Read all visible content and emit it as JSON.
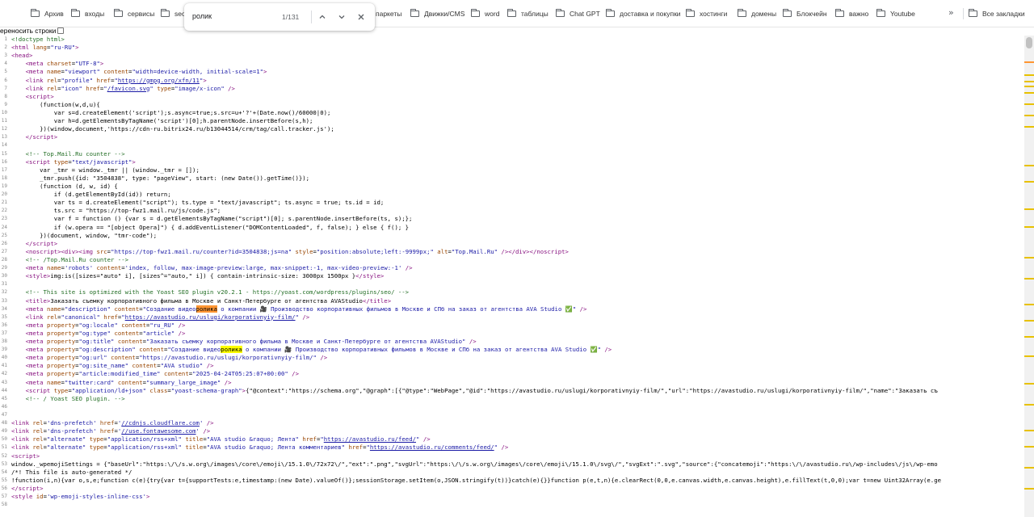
{
  "bookmarks": {
    "items": [
      {
        "label": "Архив"
      },
      {
        "label": "входы"
      },
      {
        "label": "сервисы"
      },
      {
        "label": "seo"
      },
      {
        "label": "паркеты"
      },
      {
        "label": "Движки/CMS"
      },
      {
        "label": "word"
      },
      {
        "label": "таблицы"
      },
      {
        "label": "Chat GPT"
      },
      {
        "label": "доставка и покупки"
      },
      {
        "label": "хостинги"
      },
      {
        "label": "домены"
      },
      {
        "label": "Блокчейн"
      },
      {
        "label": "важно"
      },
      {
        "label": "Youtube"
      }
    ],
    "more": "»",
    "all_label": "Все закладки"
  },
  "wrap": {
    "label": "ереносить строки"
  },
  "find": {
    "query": "ролик",
    "count": "1/131",
    "prev": "⌃",
    "next": "⌄",
    "close": "✕"
  },
  "code": {
    "lines": [
      {
        "n": "1",
        "html": "<span class=\"c\">&lt;!doctype html&gt;</span>"
      },
      {
        "n": "2",
        "html": "<span class=\"t\">&lt;html</span> <span class=\"a\">lang</span>=<span class=\"v\">\"ru-RU\"</span><span class=\"t\">&gt;</span>"
      },
      {
        "n": "3",
        "html": "<span class=\"t\">&lt;head&gt;</span>"
      },
      {
        "n": "4",
        "html": "    <span class=\"t\">&lt;meta</span> <span class=\"a\">charset</span>=<span class=\"v\">\"UTF-8\"</span><span class=\"t\">&gt;</span>"
      },
      {
        "n": "5",
        "html": "    <span class=\"t\">&lt;meta</span> <span class=\"a\">name</span>=<span class=\"v\">\"viewport\"</span> <span class=\"a\">content</span>=<span class=\"v\">\"width=device-width, initial-scale=1\"</span><span class=\"t\">&gt;</span>"
      },
      {
        "n": "6",
        "html": "    <span class=\"t\">&lt;link</span> <span class=\"a\">rel</span>=<span class=\"v\">\"profile\"</span> <span class=\"a\">href</span>=<span class=\"v\">\"</span><span class=\"u\">https://gmpg.org/xfn/11</span><span class=\"v\">\"</span><span class=\"t\">&gt;</span>"
      },
      {
        "n": "7",
        "html": "    <span class=\"t\">&lt;link</span> <span class=\"a\">rel</span>=<span class=\"v\">\"icon\"</span> <span class=\"a\">href</span>=<span class=\"v\">\"</span><span class=\"u\">/favicon.svg</span><span class=\"v\">\"</span> <span class=\"a\">type</span>=<span class=\"v\">\"image/x-icon\"</span> <span class=\"t\">/&gt;</span>"
      },
      {
        "n": "8",
        "html": "    <span class=\"t\">&lt;script&gt;</span>"
      },
      {
        "n": "9",
        "html": "        (function(w,d,u){"
      },
      {
        "n": "10",
        "html": "            var s=d.createElement('script');s.async=true;s.src=u+'?'+(Date.now()/60000|0);"
      },
      {
        "n": "11",
        "html": "            var h=d.getElementsByTagName('script')[0];h.parentNode.insertBefore(s,h);"
      },
      {
        "n": "12",
        "html": "        })(window,document,'https://cdn-ru.bitrix24.ru/b13044514/crm/tag/call.tracker.js');"
      },
      {
        "n": "13",
        "html": "    <span class=\"t\">&lt;/script&gt;</span>"
      },
      {
        "n": "14",
        "html": ""
      },
      {
        "n": "15",
        "html": "    <span class=\"c\">&lt;!-- Top.Mail.Ru counter --&gt;</span>"
      },
      {
        "n": "16",
        "html": "    <span class=\"t\">&lt;script</span> <span class=\"a\">type</span>=<span class=\"v\">\"text/javascript\"</span><span class=\"t\">&gt;</span>"
      },
      {
        "n": "17",
        "html": "        var _tmr = window._tmr || (window._tmr = []);"
      },
      {
        "n": "18",
        "html": "        _tmr.push({id: \"3504838\", type: \"pageView\", start: (new Date()).getTime()});"
      },
      {
        "n": "19",
        "html": "        (function (d, w, id) {"
      },
      {
        "n": "20",
        "html": "            if (d.getElementById(id)) return;"
      },
      {
        "n": "21",
        "html": "            var ts = d.createElement(\"script\"); ts.type = \"text/javascript\"; ts.async = true; ts.id = id;"
      },
      {
        "n": "22",
        "html": "            ts.src = \"https://top-fwz1.mail.ru/js/code.js\";"
      },
      {
        "n": "23",
        "html": "            var f = function () {var s = d.getElementsByTagName(\"script\")[0]; s.parentNode.insertBefore(ts, s);};"
      },
      {
        "n": "24",
        "html": "            if (w.opera == \"[object Opera]\") { d.addEventListener(\"DOMContentLoaded\", f, false); } else { f(); }"
      },
      {
        "n": "25",
        "html": "        })(document, window, \"tmr-code\");"
      },
      {
        "n": "26",
        "html": "    <span class=\"t\">&lt;/script&gt;</span>"
      },
      {
        "n": "27",
        "html": "    <span class=\"t\">&lt;noscript&gt;&lt;div&gt;&lt;img</span> <span class=\"a\">src</span>=<span class=\"v\">\"https://top-fwz1.mail.ru/counter?id=3504838;js=na\"</span> <span class=\"a\">style</span>=<span class=\"v\">\"position:absolute;left:-9999px;\"</span> <span class=\"a\">alt</span>=<span class=\"v\">\"Top.Mail.Ru\"</span> <span class=\"t\">/&gt;&lt;/div&gt;&lt;/noscript&gt;</span>"
      },
      {
        "n": "28",
        "html": "    <span class=\"c\">&lt;!-- /Top.Mail.Ru counter --&gt;</span>"
      },
      {
        "n": "29",
        "html": "    <span class=\"t\">&lt;meta</span> <span class=\"a\">name</span>=<span class=\"v\">'robots'</span> <span class=\"a\">content</span>=<span class=\"v\">'index, follow, max-image-preview:large, max-snippet:-1, max-video-preview:-1'</span> <span class=\"t\">/&gt;</span>"
      },
      {
        "n": "30",
        "html": "    <span class=\"t\">&lt;style&gt;</span>img:is([sizes=\"auto\" i], [sizes^=\"auto,\" i]) { contain-intrinsic-size: 3000px 1500px }<span class=\"t\">&lt;/style&gt;</span>"
      },
      {
        "n": "31",
        "html": ""
      },
      {
        "n": "32",
        "html": "    <span class=\"c\">&lt;!-- This site is optimized with the Yoast SEO plugin v20.2.1 - https://yoast.com/wordpress/plugins/seo/ --&gt;</span>"
      },
      {
        "n": "33",
        "html": "    <span class=\"t\">&lt;title&gt;</span>Заказать съемку корпоративного фильма в Москве и Санкт-Петербурге от агентства AVAStudio<span class=\"t\">&lt;/title&gt;</span>"
      },
      {
        "n": "34",
        "html": "    <span class=\"t\">&lt;meta</span> <span class=\"a\">name</span>=<span class=\"v\">\"description\"</span> <span class=\"a\">content</span>=<span class=\"v\">\"Создание видео<mark class=\"cur\">ролика</mark> о компании 🎥 Производство корпоративных фильмов в Москве и СПб на заказ от агентства AVA Studio ✅\"</span> <span class=\"t\">/&gt;</span>"
      },
      {
        "n": "35",
        "html": "    <span class=\"t\">&lt;link</span> <span class=\"a\">rel</span>=<span class=\"v\">\"canonical\"</span> <span class=\"a\">href</span>=<span class=\"v\">\"</span><span class=\"u\">https://avastudio.ru/uslugi/korporativnyiy-film/</span><span class=\"v\">\"</span> <span class=\"t\">/&gt;</span>"
      },
      {
        "n": "36",
        "html": "    <span class=\"t\">&lt;meta</span> <span class=\"a\">property</span>=<span class=\"v\">\"og:locale\"</span> <span class=\"a\">content</span>=<span class=\"v\">\"ru_RU\"</span> <span class=\"t\">/&gt;</span>"
      },
      {
        "n": "37",
        "html": "    <span class=\"t\">&lt;meta</span> <span class=\"a\">property</span>=<span class=\"v\">\"og:type\"</span> <span class=\"a\">content</span>=<span class=\"v\">\"article\"</span> <span class=\"t\">/&gt;</span>"
      },
      {
        "n": "38",
        "html": "    <span class=\"t\">&lt;meta</span> <span class=\"a\">property</span>=<span class=\"v\">\"og:title\"</span> <span class=\"a\">content</span>=<span class=\"v\">\"Заказать съемку корпоративного фильма в Москве и Санкт-Петербурге от агентства AVAStudio\"</span> <span class=\"t\">/&gt;</span>"
      },
      {
        "n": "39",
        "html": "    <span class=\"t\">&lt;meta</span> <span class=\"a\">property</span>=<span class=\"v\">\"og:description\"</span> <span class=\"a\">content</span>=<span class=\"v\">\"Создание видео<mark>ролика</mark> о компании 🎥 Производство корпоративных фильмов в Москве и СПб на заказ от агентства AVA Studio ✅\"</span> <span class=\"t\">/&gt;</span>"
      },
      {
        "n": "40",
        "html": "    <span class=\"t\">&lt;meta</span> <span class=\"a\">property</span>=<span class=\"v\">\"og:url\"</span> <span class=\"a\">content</span>=<span class=\"v\">\"https://avastudio.ru/uslugi/korporativnyiy-film/\"</span> <span class=\"t\">/&gt;</span>"
      },
      {
        "n": "41",
        "html": "    <span class=\"t\">&lt;meta</span> <span class=\"a\">property</span>=<span class=\"v\">\"og:site_name\"</span> <span class=\"a\">content</span>=<span class=\"v\">\"AVA studio\"</span> <span class=\"t\">/&gt;</span>"
      },
      {
        "n": "42",
        "html": "    <span class=\"t\">&lt;meta</span> <span class=\"a\">property</span>=<span class=\"v\">\"article:modified_time\"</span> <span class=\"a\">content</span>=<span class=\"v\">\"2025-04-24T05:25:07+00:00\"</span> <span class=\"t\">/&gt;</span>"
      },
      {
        "n": "43",
        "html": "    <span class=\"t\">&lt;meta</span> <span class=\"a\">name</span>=<span class=\"v\">\"twitter:card\"</span> <span class=\"a\">content</span>=<span class=\"v\">\"summary_large_image\"</span> <span class=\"t\">/&gt;</span>"
      },
      {
        "n": "44",
        "html": "    <span class=\"t\">&lt;script</span> <span class=\"a\">type</span>=<span class=\"v\">\"application/ld+json\"</span> <span class=\"a\">class</span>=<span class=\"v\">\"yoast-schema-graph\"</span><span class=\"t\">&gt;</span>{\"@context\":\"https://schema.org\",\"@graph\":[{\"@type\":\"WebPage\",\"@id\":\"https://avastudio.ru/uslugi/korporativnyiy-film/\",\"url\":\"https://avastudio.ru/uslugi/korporativnyiy-film/\",\"name\":\"Заказать съ"
      },
      {
        "n": "45",
        "html": "    <span class=\"c\">&lt;!-- / Yoast SEO plugin. --&gt;</span>"
      },
      {
        "n": "46",
        "html": ""
      },
      {
        "n": "47",
        "html": ""
      },
      {
        "n": "48",
        "html": "<span class=\"t\">&lt;link</span> <span class=\"a\">rel</span>=<span class=\"v\">'dns-prefetch'</span> <span class=\"a\">href</span>=<span class=\"v\">'</span><span class=\"u\">//cdnjs.cloudflare.com</span><span class=\"v\">'</span> <span class=\"t\">/&gt;</span>"
      },
      {
        "n": "49",
        "html": "<span class=\"t\">&lt;link</span> <span class=\"a\">rel</span>=<span class=\"v\">'dns-prefetch'</span> <span class=\"a\">href</span>=<span class=\"v\">'</span><span class=\"u\">//use.fontawesome.com</span><span class=\"v\">'</span> <span class=\"t\">/&gt;</span>"
      },
      {
        "n": "50",
        "html": "<span class=\"t\">&lt;link</span> <span class=\"a\">rel</span>=<span class=\"v\">\"alternate\"</span> <span class=\"a\">type</span>=<span class=\"v\">\"application/rss+xml\"</span> <span class=\"a\">title</span>=<span class=\"v\">\"AVA studio &amp;raquo; Лента\"</span> <span class=\"a\">href</span>=<span class=\"v\">\"</span><span class=\"u\">https://avastudio.ru/feed/</span><span class=\"v\">\"</span> <span class=\"t\">/&gt;</span>"
      },
      {
        "n": "51",
        "html": "<span class=\"t\">&lt;link</span> <span class=\"a\">rel</span>=<span class=\"v\">\"alternate\"</span> <span class=\"a\">type</span>=<span class=\"v\">\"application/rss+xml\"</span> <span class=\"a\">title</span>=<span class=\"v\">\"AVA studio &amp;raquo; Лента комментариев\"</span> <span class=\"a\">href</span>=<span class=\"v\">\"</span><span class=\"u\">https://avastudio.ru/comments/feed/</span><span class=\"v\">\"</span> <span class=\"t\">/&gt;</span>"
      },
      {
        "n": "52",
        "html": "<span class=\"t\">&lt;script&gt;</span>"
      },
      {
        "n": "53",
        "html": "window._wpemojiSettings = {\"baseUrl\":\"https:\\/\\/s.w.org\\/images\\/core\\/emoji\\/15.1.0\\/72x72\\/\",\"ext\":\".png\",\"svgUrl\":\"https:\\/\\/s.w.org\\/images\\/core\\/emoji\\/15.1.0\\/svg\\/\",\"svgExt\":\".svg\",\"source\":{\"concatemoji\":\"https:\\/\\/avastudio.ru\\/wp-includes\\/js\\/wp-emo"
      },
      {
        "n": "54",
        "html": "/*! This file is auto-generated */"
      },
      {
        "n": "55",
        "html": "!function(i,n){var o,s,e;function c(e){try{var t={supportTests:e,timestamp:(new Date).valueOf()};sessionStorage.setItem(o,JSON.stringify(t))}catch(e){}}function p(e,t,n){e.clearRect(0,0,e.canvas.width,e.canvas.height),e.fillText(t,0,0);var t=new Uint32Array(e.ge"
      },
      {
        "n": "56",
        "html": "<span class=\"t\">&lt;/script&gt;</span>"
      },
      {
        "n": "57",
        "html": "<span class=\"t\">&lt;style</span> <span class=\"a\">id</span>=<span class=\"v\">'wp-emoji-styles-inline-css'</span><span class=\"t\">&gt;</span>"
      },
      {
        "n": "58",
        "html": ""
      }
    ]
  },
  "colors": {
    "current_match": "#ff9632",
    "match": "#ffff00",
    "tag": "#881280",
    "attr": "#994500",
    "value": "#1a1aa6",
    "comment": "#236e25"
  },
  "icons": [
    "folder-icon",
    "chevron-up-icon",
    "chevron-down-icon",
    "close-icon",
    "overflow-chevron-icon"
  ]
}
